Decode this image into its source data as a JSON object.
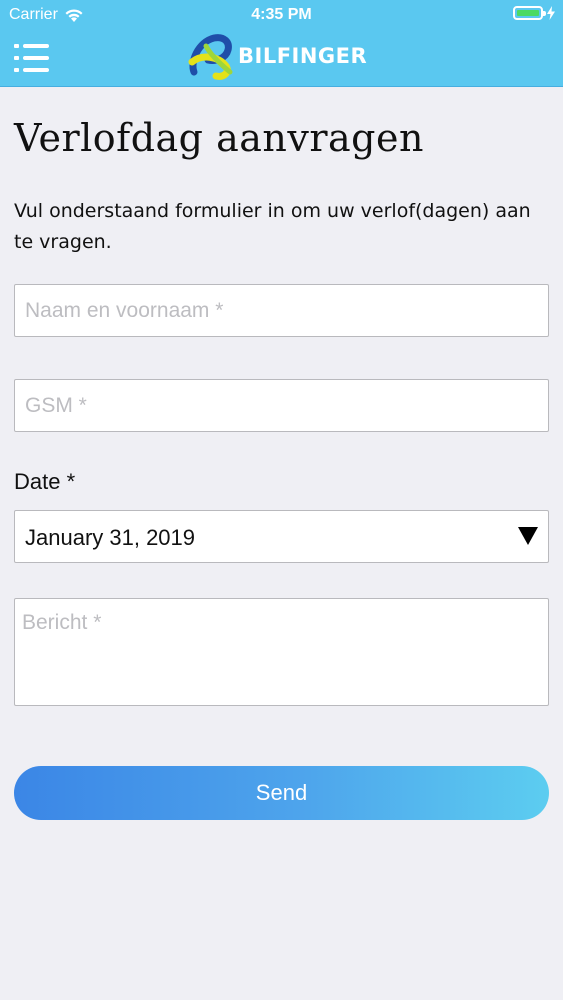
{
  "status_bar": {
    "carrier": "Carrier",
    "time": "4:35 PM",
    "battery_color": "#4cd964"
  },
  "header": {
    "menu_icon": "hamburger-menu-icon",
    "brand": "BILFINGER",
    "background_color": "#5ac8f0"
  },
  "page": {
    "title": "Verlofdag aanvragen",
    "intro": "Vul onderstaand formulier in om uw verlof(dagen) aan te vragen."
  },
  "form": {
    "name_placeholder": "Naam en voornaam *",
    "gsm_placeholder": "GSM *",
    "date_label": "Date *",
    "date_value": "January 31, 2019",
    "message_placeholder": "Bericht *",
    "send_label": "Send"
  },
  "colors": {
    "accent_start": "#3b86e6",
    "accent_end": "#5ccdf0"
  }
}
